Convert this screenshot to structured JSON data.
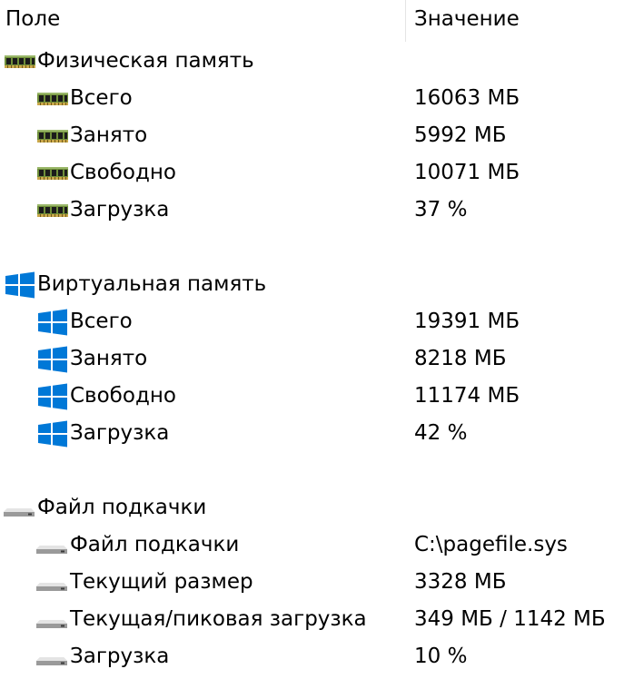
{
  "header": {
    "field": "Поле",
    "value": "Значение"
  },
  "sections": [
    {
      "title": "Физическая память",
      "icon": "ram-icon",
      "items": [
        {
          "label": "Всего",
          "value": "16063 МБ"
        },
        {
          "label": "Занято",
          "value": "5992 МБ"
        },
        {
          "label": "Свободно",
          "value": "10071 МБ"
        },
        {
          "label": "Загрузка",
          "value": "37 %"
        }
      ]
    },
    {
      "title": "Виртуальная память",
      "icon": "windows-icon",
      "items": [
        {
          "label": "Всего",
          "value": "19391 МБ"
        },
        {
          "label": "Занято",
          "value": "8218 МБ"
        },
        {
          "label": "Свободно",
          "value": "11174 МБ"
        },
        {
          "label": "Загрузка",
          "value": "42 %"
        }
      ]
    },
    {
      "title": "Файл подкачки",
      "icon": "drive-icon",
      "items": [
        {
          "label": "Файл подкачки",
          "value": "C:\\pagefile.sys"
        },
        {
          "label": "Текущий размер",
          "value": "3328 МБ"
        },
        {
          "label": "Текущая/пиковая загрузка",
          "value": "349 МБ / 1142 МБ"
        },
        {
          "label": "Загрузка",
          "value": "10 %"
        }
      ]
    }
  ],
  "colors": {
    "ram_board": "#2f6b2f",
    "ram_chip": "#1b1b1b",
    "windows_blue": "#0078d7",
    "drive_body": "#b8b8b8"
  }
}
